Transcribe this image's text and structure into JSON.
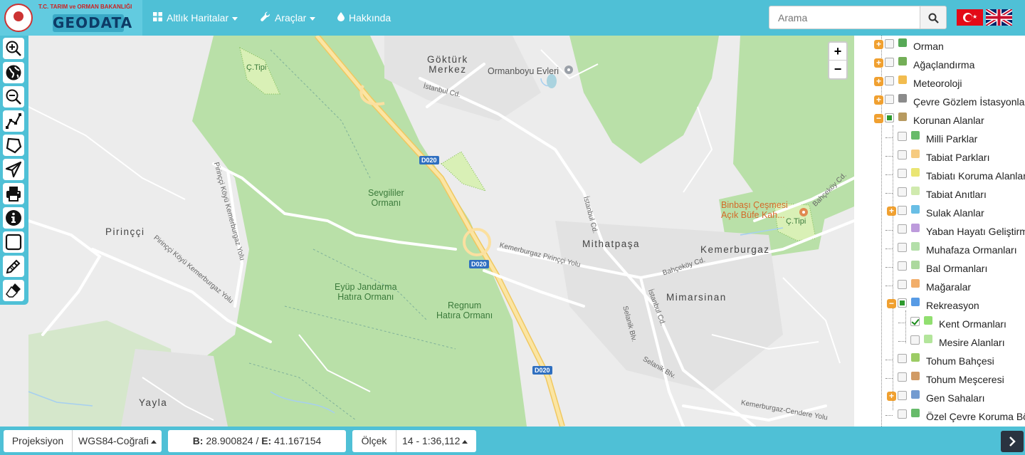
{
  "brand": {
    "ministry": "T.C. TARIM ve ORMAN BAKANLIĞI",
    "app_name": "GEODATA"
  },
  "nav": {
    "basemaps": "Altlık Haritalar",
    "tools": "Araçlar",
    "about": "Hakkında"
  },
  "search": {
    "placeholder": "Arama"
  },
  "icons": {
    "basemaps": "grid-icon",
    "tools": "wrench-icon",
    "about": "drop-icon",
    "search": "search-icon",
    "next": "chevron-right-icon"
  },
  "colors": {
    "topbar": "#4fc0d6",
    "map_bg": "#ececec",
    "park": "#b7dfa6",
    "road_main": "#fad88a",
    "road": "#ffffff"
  },
  "toolbar_tools": [
    "zoom-in-icon",
    "globe-icon",
    "zoom-out-icon",
    "measure-line-icon",
    "measure-area-icon",
    "send-location-icon",
    "print-icon",
    "info-icon",
    "select-box-icon",
    "draw-icon",
    "eraser-icon"
  ],
  "zoom": {
    "plus": "+",
    "minus": "−"
  },
  "map": {
    "labels": {
      "cilfi_1": "Ç.Tipi",
      "cilfi_2": "Ç.Tipi",
      "gokturk": "Göktürk\nMerkez",
      "ormanboyu": "Ormanboyu Evleri",
      "istanbul_cd_1": "İstanbul Cd.",
      "istanbul_cd_2": "İstanbul Cd.",
      "istanbul_cd_3": "İstanbul Cd.",
      "sevgililer": "Sevgililer\nOrmanı",
      "pirincci": "Pirinççi",
      "pirincci_koyu_1": "Pirinççi Köyü Kemerburgaz Yolu",
      "pirincci_koyu_2": "Pirinççi Köyü Kemerburgaz Yolu",
      "kemerburgaz_pirincci": "Kemerburgaz Pirinççi Yolu",
      "mithatpasa": "Mithatpaşa",
      "kemerburgaz": "Kemerburgaz",
      "mimarsinan": "Mimarsinan",
      "bahcekoy_cd_1": "Bahçeköy Cd.",
      "bahcekoy_cd_2": "Bahçeköy Cd.",
      "eyup": "Eyüp Jandarma\nHatıra Ormanı",
      "regnum": "Regnum\nHatıra Ormanı",
      "selanik_1": "Selanik Blv.",
      "selanik_2": "Selanik Blv.",
      "binbasi": "Binbaşı Çeşmesi\nAçık Büfe Kah...",
      "yayla": "Yayla",
      "kemerburgaz_cendere": "Kemerburgaz-Cendere Yolu"
    },
    "shields": [
      "D020",
      "D020",
      "D020"
    ]
  },
  "layers": [
    {
      "label": "Orman",
      "expander": "+",
      "checked": false,
      "icon_color": "#3a9a3a"
    },
    {
      "label": "Ağaçlandırma",
      "expander": "+",
      "checked": false,
      "icon_color": "#5aa03a"
    },
    {
      "label": "Meteoroloji",
      "expander": "+",
      "checked": false,
      "icon_color": "#f0b030"
    },
    {
      "label": "Çevre Gözlem İstasyonları",
      "expander": "+",
      "checked": false,
      "icon_color": "#777777"
    },
    {
      "label": "Korunan Alanlar",
      "expander": "−",
      "checked": "partial",
      "icon_color": "#aa8844"
    },
    {
      "label": "Milli Parklar",
      "checked": false,
      "icon_color": "#4caf50"
    },
    {
      "label": "Tabiat Parkları",
      "checked": false,
      "icon_color": "#f5c26b"
    },
    {
      "label": "Tabiatı Koruma Alanları",
      "checked": false,
      "icon_color": "#e6e05a"
    },
    {
      "label": "Tabiat Anıtları",
      "checked": false,
      "icon_color": "#c8e6a0"
    },
    {
      "label": "Sulak Alanlar",
      "expander": "+",
      "checked": false,
      "icon_color": "#4fb3e0"
    },
    {
      "label": "Yaban Hayatı Geliştirme",
      "checked": false,
      "icon_color": "#b28ad6"
    },
    {
      "label": "Muhafaza Ormanları",
      "checked": false,
      "icon_color": "#a6d99a"
    },
    {
      "label": "Bal Ormanları",
      "checked": false,
      "icon_color": "#9ed28c"
    },
    {
      "label": "Mağaralar",
      "checked": false,
      "icon_color": "#f0a050"
    },
    {
      "label": "Rekreasyon",
      "expander": "−",
      "checked": "partial",
      "icon_color": "#3a8ae0"
    },
    {
      "label": "Kent Ormanları",
      "checked": true,
      "icon_color": "#7ed957"
    },
    {
      "label": "Mesire Alanları",
      "checked": false,
      "icon_color": "#a6e08a"
    },
    {
      "label": "Tohum Bahçesi",
      "checked": false,
      "icon_color": "#8bc34a"
    },
    {
      "label": "Tohum Meşceresi",
      "checked": false,
      "icon_color": "#c98a4a"
    },
    {
      "label": "Gen Sahaları",
      "expander": "+",
      "checked": false,
      "icon_color": "#5a8ac8"
    },
    {
      "label": "Özel Çevre Koruma Bölgeleri",
      "checked": false,
      "icon_color": "#4caf50"
    }
  ],
  "bottom": {
    "projection_label": "Projeksiyon",
    "projection_value": "WGS84-Coğrafi",
    "coord_b_label": "B:",
    "coord_b_value": "28.900824",
    "coord_sep": "/",
    "coord_e_label": "E:",
    "coord_e_value": "41.167154",
    "scale_label": "Ölçek",
    "scale_value": "14 - 1:36,112"
  }
}
